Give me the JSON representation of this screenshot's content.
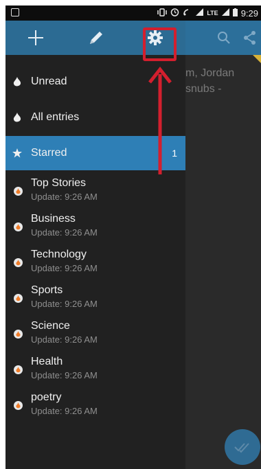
{
  "status_bar": {
    "network": "LTE",
    "time": "9:29"
  },
  "background": {
    "text_line1": "m, Jordan",
    "text_line2": "snubs -"
  },
  "drawer": {
    "header": {
      "add_icon": "plus-icon",
      "edit_icon": "pencil-icon",
      "settings_icon": "gear-icon"
    },
    "items": [
      {
        "label": "Unread",
        "icon": "flame-icon"
      },
      {
        "label": "All entries",
        "icon": "flame-icon"
      },
      {
        "label": "Starred",
        "icon": "star-icon",
        "count": "1",
        "selected": true
      }
    ],
    "feeds": [
      {
        "title": "Top Stories",
        "subtitle": "Update: 9:26 AM"
      },
      {
        "title": "Business",
        "subtitle": "Update: 9:26 AM"
      },
      {
        "title": "Technology",
        "subtitle": "Update: 9:26 AM"
      },
      {
        "title": "Sports",
        "subtitle": "Update: 9:26 AM"
      },
      {
        "title": "Science",
        "subtitle": "Update: 9:26 AM"
      },
      {
        "title": "Health",
        "subtitle": "Update: 9:26 AM"
      },
      {
        "title": "poetry",
        "subtitle": "Update: 9:26 AM"
      }
    ]
  },
  "colors": {
    "header_blue": "#2c6b93",
    "selected_blue": "#2e7fb6",
    "drawer_bg": "#212121",
    "annotation_red": "#d31f2e",
    "feed_icon_orange": "#f07d2a"
  }
}
